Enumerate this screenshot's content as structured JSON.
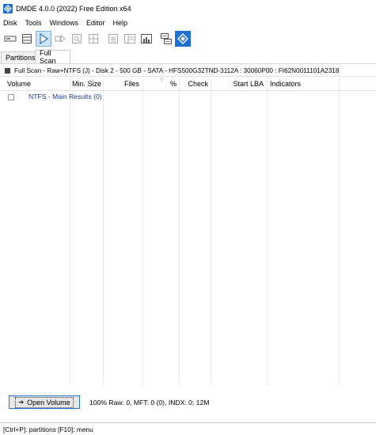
{
  "window": {
    "title": "DMDE 4.0.0 (2022) Free Edition x64"
  },
  "menu": [
    "Disk",
    "Tools",
    "Windows",
    "Editor",
    "Help"
  ],
  "toolbar": {
    "buttons": [
      {
        "icon": "drive-icon"
      },
      {
        "icon": "partitions-list-icon"
      },
      {
        "icon": "play-icon",
        "active": true
      },
      {
        "icon": "step-forward-icon"
      },
      {
        "icon": "search-scan-icon"
      },
      {
        "icon": "grid-view-icon"
      },
      {
        "icon": "list-view-icon"
      },
      {
        "icon": "details-view-icon"
      },
      {
        "icon": "chart-icon"
      },
      {
        "icon": "copy-sectors-icon"
      },
      {
        "icon": "dmde-logo-icon",
        "brand": true
      }
    ]
  },
  "tabs": [
    {
      "label": "Partitions",
      "active": false
    },
    {
      "label": "Full Scan",
      "active": true
    }
  ],
  "panel": {
    "header": "Full Scan - Raw+NTFS (J) - Disk 2 - 500 GB - SATA - HFS500G32TND-3112A : 30060P00 : FI62N0011101A2318"
  },
  "table": {
    "columns": [
      "Volume",
      "Min. Size",
      "Files",
      "%",
      "Check",
      "Start LBA",
      "Indicators"
    ],
    "rows": [
      {
        "volume": "NTFS - Main Results (0)"
      }
    ]
  },
  "bottom": {
    "open_volume_label": "Open Volume",
    "summary": "100% Raw: 0, MFT: 0 (0), INDX: 0; 12M"
  },
  "statusbar": {
    "text": "[Ctrl+P]: partitions  [F10]: menu"
  },
  "colors": {
    "accent": "#1f6fd0",
    "active_button": "#cce4f7",
    "result_text": "#1a3a8f"
  }
}
